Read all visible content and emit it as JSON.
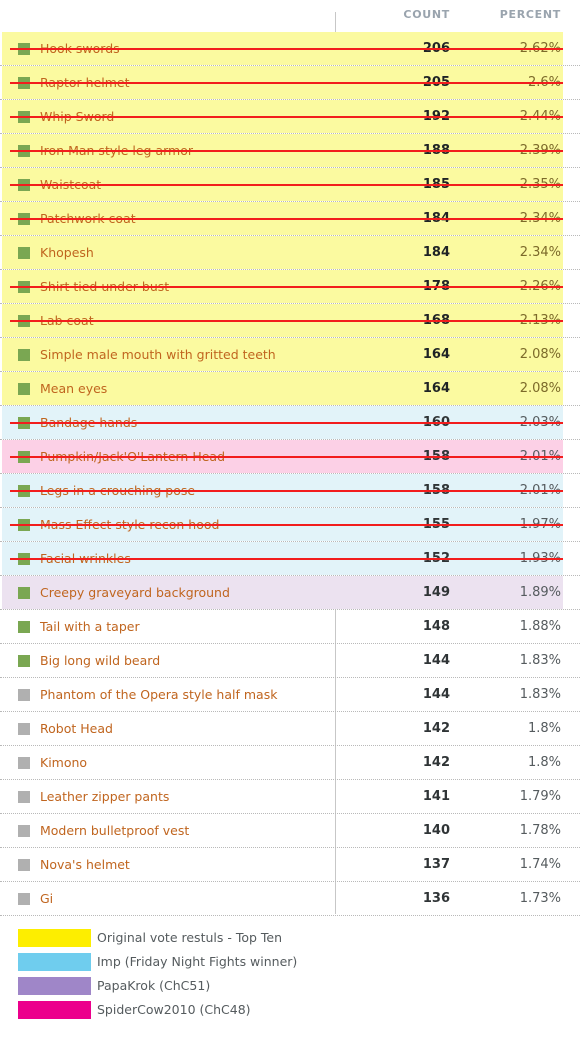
{
  "table": {
    "columns": [
      "COUNT",
      "PERCENT"
    ],
    "rows": [
      {
        "label": "Hook swords",
        "count": "206",
        "percent": "2.62%",
        "swatch": "green",
        "highlight": "yellow",
        "struck": true
      },
      {
        "label": "Raptor helmet",
        "count": "205",
        "percent": "2.6%",
        "swatch": "green",
        "highlight": "yellow",
        "struck": true
      },
      {
        "label": "Whip Sword",
        "count": "192",
        "percent": "2.44%",
        "swatch": "green",
        "highlight": "yellow",
        "struck": true
      },
      {
        "label": "Iron Man style leg armor",
        "count": "188",
        "percent": "2.39%",
        "swatch": "green",
        "highlight": "yellow",
        "struck": true
      },
      {
        "label": "Waistcoat",
        "count": "185",
        "percent": "2.35%",
        "swatch": "green",
        "highlight": "yellow",
        "struck": true
      },
      {
        "label": "Patchwork coat",
        "count": "184",
        "percent": "2.34%",
        "swatch": "green",
        "highlight": "yellow",
        "struck": true
      },
      {
        "label": "Khopesh",
        "count": "184",
        "percent": "2.34%",
        "swatch": "green",
        "highlight": "yellow",
        "struck": false
      },
      {
        "label": "Shirt tied under bust",
        "count": "178",
        "percent": "2.26%",
        "swatch": "green",
        "highlight": "yellow",
        "struck": true
      },
      {
        "label": "Lab coat",
        "count": "168",
        "percent": "2.13%",
        "swatch": "green",
        "highlight": "yellow",
        "struck": true
      },
      {
        "label": "Simple male mouth with gritted teeth",
        "count": "164",
        "percent": "2.08%",
        "swatch": "green",
        "highlight": "yellow",
        "struck": false
      },
      {
        "label": "Mean eyes",
        "count": "164",
        "percent": "2.08%",
        "swatch": "green",
        "highlight": "yellow",
        "struck": false
      },
      {
        "label": "Bandage hands",
        "count": "160",
        "percent": "2.03%",
        "swatch": "green",
        "highlight": "blue",
        "struck": true
      },
      {
        "label": "Pumpkin/Jack'O'Lantern Head",
        "count": "158",
        "percent": "2.01%",
        "swatch": "green",
        "highlight": "pink",
        "struck": true
      },
      {
        "label": "Legs in a crouching pose",
        "count": "158",
        "percent": "2.01%",
        "swatch": "green",
        "highlight": "blue",
        "struck": true
      },
      {
        "label": "Mass Effect style recon hood",
        "count": "155",
        "percent": "1.97%",
        "swatch": "green",
        "highlight": "blue",
        "struck": true
      },
      {
        "label": "Facial wrinkles",
        "count": "152",
        "percent": "1.93%",
        "swatch": "green",
        "highlight": "blue",
        "struck": true
      },
      {
        "label": "Creepy graveyard background",
        "count": "149",
        "percent": "1.89%",
        "swatch": "green",
        "highlight": "purple",
        "struck": false
      },
      {
        "label": "Tail with a taper",
        "count": "148",
        "percent": "1.88%",
        "swatch": "green",
        "highlight": "none",
        "struck": false
      },
      {
        "label": "Big long wild beard",
        "count": "144",
        "percent": "1.83%",
        "swatch": "green",
        "highlight": "none",
        "struck": false
      },
      {
        "label": "Phantom of the Opera style half mask",
        "count": "144",
        "percent": "1.83%",
        "swatch": "grey",
        "highlight": "none",
        "struck": false
      },
      {
        "label": "Robot Head",
        "count": "142",
        "percent": "1.8%",
        "swatch": "grey",
        "highlight": "none",
        "struck": false
      },
      {
        "label": "Kimono",
        "count": "142",
        "percent": "1.8%",
        "swatch": "grey",
        "highlight": "none",
        "struck": false
      },
      {
        "label": "Leather zipper pants",
        "count": "141",
        "percent": "1.79%",
        "swatch": "grey",
        "highlight": "none",
        "struck": false
      },
      {
        "label": "Modern bulletproof vest",
        "count": "140",
        "percent": "1.78%",
        "swatch": "grey",
        "highlight": "none",
        "struck": false
      },
      {
        "label": "Nova's helmet",
        "count": "137",
        "percent": "1.74%",
        "swatch": "grey",
        "highlight": "none",
        "struck": false
      },
      {
        "label": "Gi",
        "count": "136",
        "percent": "1.73%",
        "swatch": "grey",
        "highlight": "none",
        "struck": false
      }
    ]
  },
  "legend": {
    "items": [
      {
        "label": "Original vote restuls - Top Ten",
        "color": "#fdee00"
      },
      {
        "label": "Imp (Friday Night Fights winner)",
        "color": "#6fcdee"
      },
      {
        "label": "PapaKrok (ChC51)",
        "color": "#9f86c8"
      },
      {
        "label": "SpiderCow2010 (ChC48)",
        "color": "#ec008c"
      }
    ]
  },
  "colors": {
    "highlight_yellow": "#fbfaa0",
    "highlight_blue": "#e2f3f9",
    "highlight_pink": "#fcd0e6",
    "highlight_purple": "#ece2f0",
    "swatch_green": "#7aa752",
    "swatch_grey": "#b0b0b0",
    "strike_red": "#f21d1d",
    "label_text": "#c0651f",
    "header_text": "#9aa4ae"
  }
}
